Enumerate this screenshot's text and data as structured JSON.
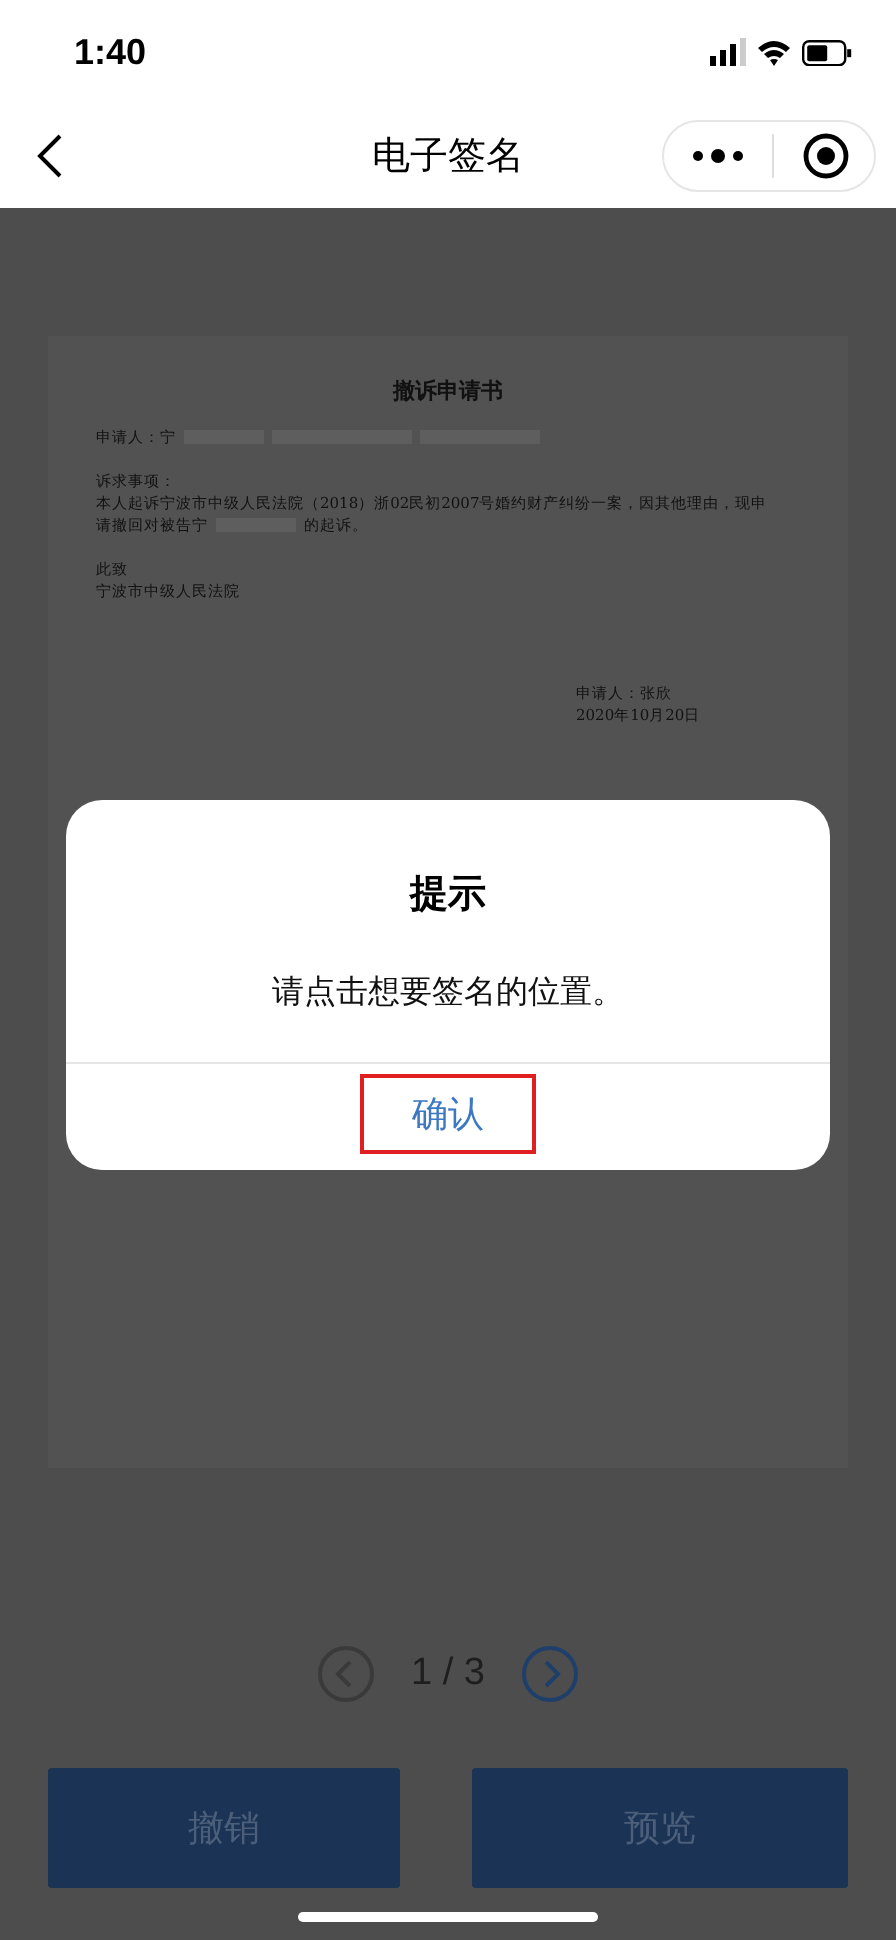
{
  "status_bar": {
    "time": "1:40"
  },
  "nav": {
    "title": "电子签名"
  },
  "document": {
    "title": "撤诉申请书",
    "lines": [
      {
        "kind": "redacted",
        "text": "申请人：宁"
      },
      {
        "kind": "gap"
      },
      {
        "kind": "text",
        "text": "诉求事项："
      },
      {
        "kind": "text",
        "text": "本人起诉宁波市中级人民法院（2018）浙02民初2007号婚约财产纠纷一案，因其他理由，现申"
      },
      {
        "kind": "redacted_inline",
        "text": "请撤回对被告宁",
        "after": "的起诉。"
      },
      {
        "kind": "gap"
      },
      {
        "kind": "text",
        "text": "此致"
      },
      {
        "kind": "text",
        "text": "宁波市中级人民法院"
      }
    ],
    "signer": "申请人：张欣",
    "date": "2020年10月20日"
  },
  "dialog": {
    "title": "提示",
    "message": "请点击想要签名的位置。",
    "confirm": {
      "label": "确认",
      "highlighted": true
    }
  },
  "pager": {
    "text": "1 / 3",
    "prev_disabled": true,
    "next_disabled": false
  },
  "buttons": [
    {
      "label": "撤销"
    },
    {
      "label": "预览"
    }
  ]
}
